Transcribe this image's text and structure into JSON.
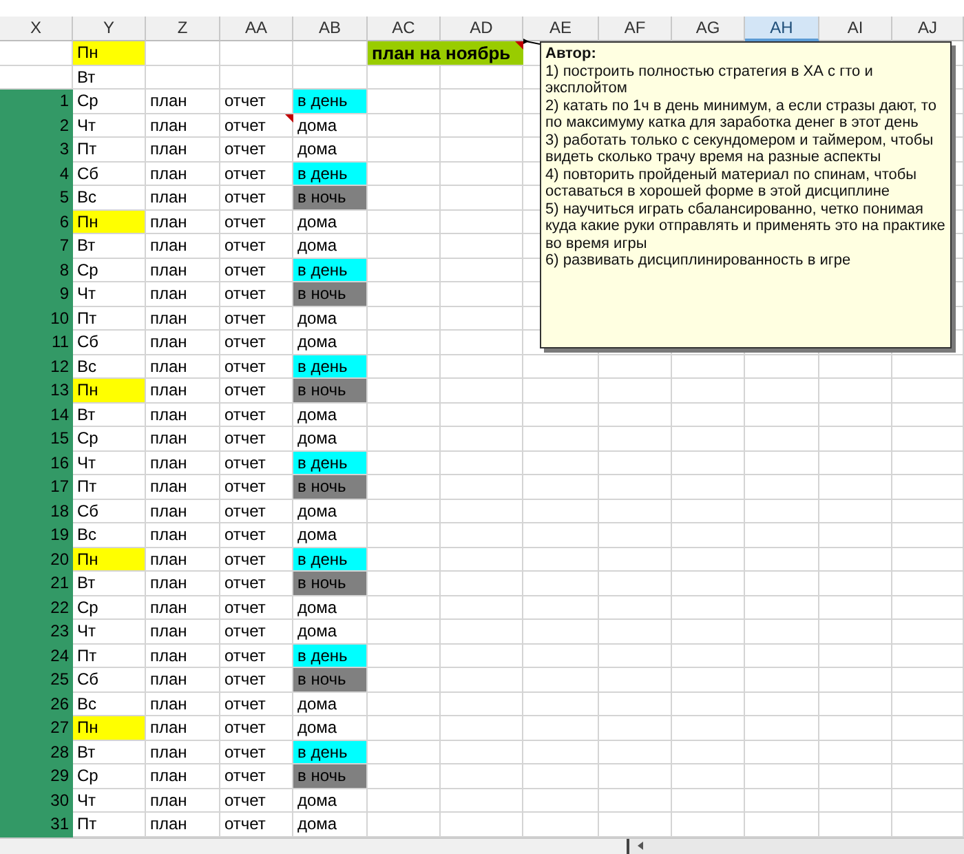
{
  "columns": [
    {
      "label": "X",
      "selected": false
    },
    {
      "label": "Y",
      "selected": false
    },
    {
      "label": "Z",
      "selected": false
    },
    {
      "label": "AA",
      "selected": false
    },
    {
      "label": "AB",
      "selected": false
    },
    {
      "label": "AC",
      "selected": false
    },
    {
      "label": "AD",
      "selected": false
    },
    {
      "label": "AE",
      "selected": false
    },
    {
      "label": "AF",
      "selected": false
    },
    {
      "label": "AG",
      "selected": false
    },
    {
      "label": "AH",
      "selected": true
    },
    {
      "label": "AI",
      "selected": false
    },
    {
      "label": "AJ",
      "selected": false
    }
  ],
  "top_rows": [
    {
      "day": "Пн",
      "highlighted": true,
      "title": "план на ноябрь",
      "has_comment": true
    },
    {
      "day": "Вт",
      "highlighted": false
    }
  ],
  "rows": [
    {
      "number": "1",
      "day": "Ср",
      "highlighted": false,
      "plan": "план",
      "report": "отчет",
      "mode": "в день",
      "kind": "day",
      "has_comment": false
    },
    {
      "number": "2",
      "day": "Чт",
      "highlighted": false,
      "plan": "план",
      "report": "отчет",
      "mode": "дома",
      "kind": "home",
      "has_comment": true
    },
    {
      "number": "3",
      "day": "Пт",
      "highlighted": false,
      "plan": "план",
      "report": "отчет",
      "mode": "дома",
      "kind": "home",
      "has_comment": false
    },
    {
      "number": "4",
      "day": "Сб",
      "highlighted": false,
      "plan": "план",
      "report": "отчет",
      "mode": "в день",
      "kind": "day",
      "has_comment": false
    },
    {
      "number": "5",
      "day": "Вс",
      "highlighted": false,
      "plan": "план",
      "report": "отчет",
      "mode": "в ночь",
      "kind": "night",
      "has_comment": false
    },
    {
      "number": "6",
      "day": "Пн",
      "highlighted": true,
      "plan": "план",
      "report": "отчет",
      "mode": "дома",
      "kind": "home",
      "has_comment": false
    },
    {
      "number": "7",
      "day": "Вт",
      "highlighted": false,
      "plan": "план",
      "report": "отчет",
      "mode": "дома",
      "kind": "home",
      "has_comment": false
    },
    {
      "number": "8",
      "day": "Ср",
      "highlighted": false,
      "plan": "план",
      "report": "отчет",
      "mode": "в день",
      "kind": "day",
      "has_comment": false
    },
    {
      "number": "9",
      "day": "Чт",
      "highlighted": false,
      "plan": "план",
      "report": "отчет",
      "mode": "в ночь",
      "kind": "night",
      "has_comment": false
    },
    {
      "number": "10",
      "day": "Пт",
      "highlighted": false,
      "plan": "план",
      "report": "отчет",
      "mode": "дома",
      "kind": "home",
      "has_comment": false
    },
    {
      "number": "11",
      "day": "Сб",
      "highlighted": false,
      "plan": "план",
      "report": "отчет",
      "mode": "дома",
      "kind": "home",
      "has_comment": false
    },
    {
      "number": "12",
      "day": "Вс",
      "highlighted": false,
      "plan": "план",
      "report": "отчет",
      "mode": "в день",
      "kind": "day",
      "has_comment": false
    },
    {
      "number": "13",
      "day": "Пн",
      "highlighted": true,
      "plan": "план",
      "report": "отчет",
      "mode": "в ночь",
      "kind": "night",
      "has_comment": false
    },
    {
      "number": "14",
      "day": "Вт",
      "highlighted": false,
      "plan": "план",
      "report": "отчет",
      "mode": "дома",
      "kind": "home",
      "has_comment": false
    },
    {
      "number": "15",
      "day": "Ср",
      "highlighted": false,
      "plan": "план",
      "report": "отчет",
      "mode": "дома",
      "kind": "home",
      "has_comment": false
    },
    {
      "number": "16",
      "day": "Чт",
      "highlighted": false,
      "plan": "план",
      "report": "отчет",
      "mode": "в день",
      "kind": "day",
      "has_comment": false
    },
    {
      "number": "17",
      "day": "Пт",
      "highlighted": false,
      "plan": "план",
      "report": "отчет",
      "mode": "в ночь",
      "kind": "night",
      "has_comment": false
    },
    {
      "number": "18",
      "day": "Сб",
      "highlighted": false,
      "plan": "план",
      "report": "отчет",
      "mode": "дома",
      "kind": "home",
      "has_comment": false
    },
    {
      "number": "19",
      "day": "Вс",
      "highlighted": false,
      "plan": "план",
      "report": "отчет",
      "mode": "дома",
      "kind": "home",
      "has_comment": false
    },
    {
      "number": "20",
      "day": "Пн",
      "highlighted": true,
      "plan": "план",
      "report": "отчет",
      "mode": "в день",
      "kind": "day",
      "has_comment": false
    },
    {
      "number": "21",
      "day": "Вт",
      "highlighted": false,
      "plan": "план",
      "report": "отчет",
      "mode": "в ночь",
      "kind": "night",
      "has_comment": false
    },
    {
      "number": "22",
      "day": "Ср",
      "highlighted": false,
      "plan": "план",
      "report": "отчет",
      "mode": "дома",
      "kind": "home",
      "has_comment": false
    },
    {
      "number": "23",
      "day": "Чт",
      "highlighted": false,
      "plan": "план",
      "report": "отчет",
      "mode": "дома",
      "kind": "home",
      "has_comment": false
    },
    {
      "number": "24",
      "day": "Пт",
      "highlighted": false,
      "plan": "план",
      "report": "отчет",
      "mode": "в день",
      "kind": "day",
      "has_comment": false
    },
    {
      "number": "25",
      "day": "Сб",
      "highlighted": false,
      "plan": "план",
      "report": "отчет",
      "mode": "в ночь",
      "kind": "night",
      "has_comment": false
    },
    {
      "number": "26",
      "day": "Вс",
      "highlighted": false,
      "plan": "план",
      "report": "отчет",
      "mode": "дома",
      "kind": "home",
      "has_comment": false
    },
    {
      "number": "27",
      "day": "Пн",
      "highlighted": true,
      "plan": "план",
      "report": "отчет",
      "mode": "дома",
      "kind": "home",
      "has_comment": false
    },
    {
      "number": "28",
      "day": "Вт",
      "highlighted": false,
      "plan": "план",
      "report": "отчет",
      "mode": "в день",
      "kind": "day",
      "has_comment": false
    },
    {
      "number": "29",
      "day": "Ср",
      "highlighted": false,
      "plan": "план",
      "report": "отчет",
      "mode": "в ночь",
      "kind": "night",
      "has_comment": false
    },
    {
      "number": "30",
      "day": "Чт",
      "highlighted": false,
      "plan": "план",
      "report": "отчет",
      "mode": "дома",
      "kind": "home",
      "has_comment": false
    },
    {
      "number": "31",
      "day": "Пт",
      "highlighted": false,
      "plan": "план",
      "report": "отчет",
      "mode": "дома",
      "kind": "home",
      "has_comment": false
    }
  ],
  "comment": {
    "author": "Автор:",
    "lines": [
      "1) построить полностью стратегия в ХА с гто и эксплойтом",
      "2) катать по 1ч в день минимум, а если стразы дают, то по максимуму катка для заработка денег в этот день",
      "3) работать только с секундомером и таймером, чтобы видеть сколько трачу время на разные аспекты",
      "4) повторить пройденый материал по спинам, чтобы оставаться в хорошей форме в этой дисциплине",
      "5) научиться играть сбалансированно, четко понимая куда какие руки отправлять и применять это на практике во время игры",
      "6) развивать дисциплинированность в игре"
    ]
  }
}
